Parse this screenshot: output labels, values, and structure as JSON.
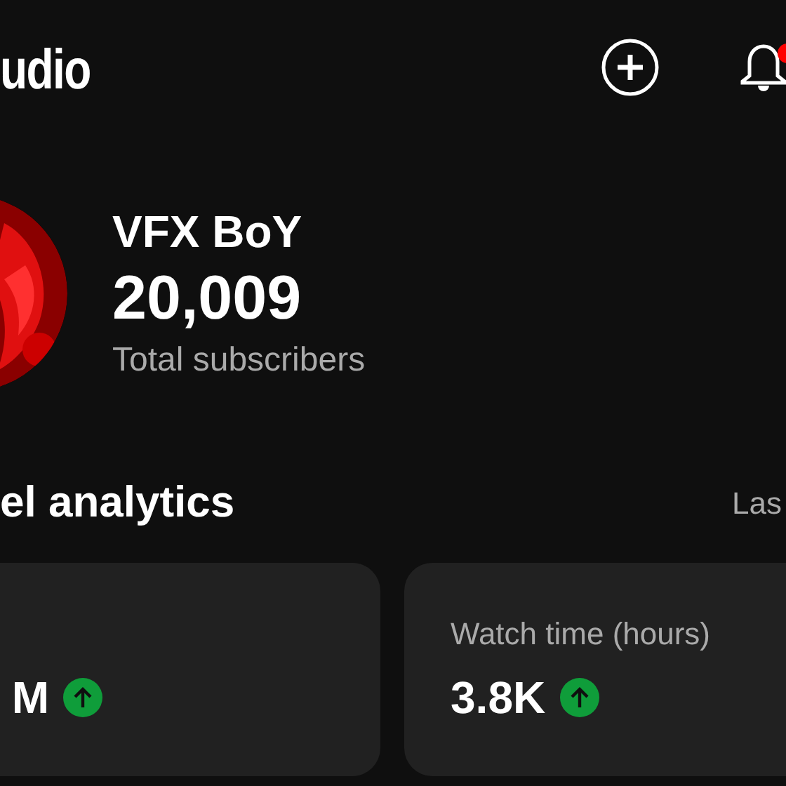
{
  "header": {
    "title": "udio",
    "unread_notifications": true
  },
  "channel": {
    "name": "VFX BoY",
    "subscribers": "20,009",
    "subscribers_label": "Total subscribers"
  },
  "analytics": {
    "title": "el analytics",
    "period": "Las",
    "cards": [
      {
        "value": "M",
        "trending_up": true
      },
      {
        "label": "Watch time (hours)",
        "value": "3.8K",
        "trending_up": true
      }
    ]
  }
}
